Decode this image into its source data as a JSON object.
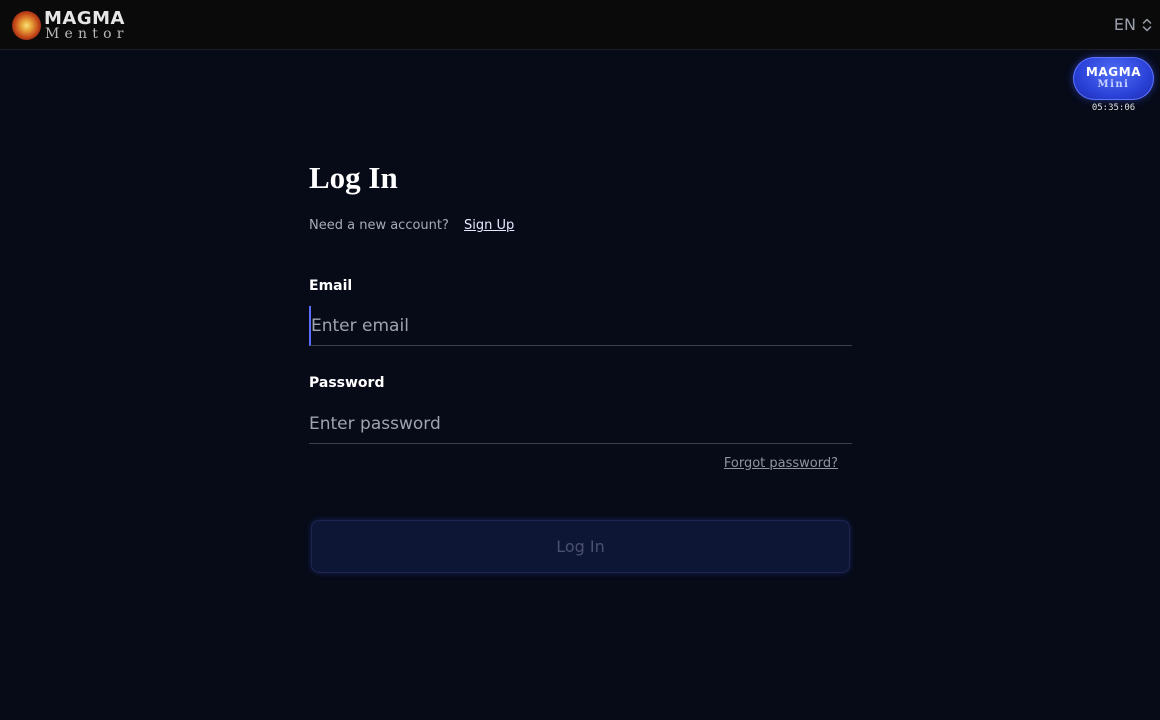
{
  "header": {
    "logo": {
      "top": "MAGMA",
      "bottom": "Mentor"
    },
    "language": {
      "selected": "EN",
      "icon": "chevron-up-down-icon"
    }
  },
  "mini_badge": {
    "top": "MAGMA",
    "bottom": "Mini",
    "timer": "05:35:06"
  },
  "form": {
    "title": "Log In",
    "signup_prompt": "Need a new account?",
    "signup_link": "Sign Up",
    "email": {
      "label": "Email",
      "placeholder": "Enter email",
      "value": ""
    },
    "password": {
      "label": "Password",
      "placeholder": "Enter password",
      "value": ""
    },
    "forgot_link": "Forgot password?",
    "submit_label": "Log In"
  },
  "colors": {
    "background": "#070b18",
    "header": "#0a0a0a",
    "accent": "#2b42d8",
    "button_disabled": "#0e1636"
  }
}
